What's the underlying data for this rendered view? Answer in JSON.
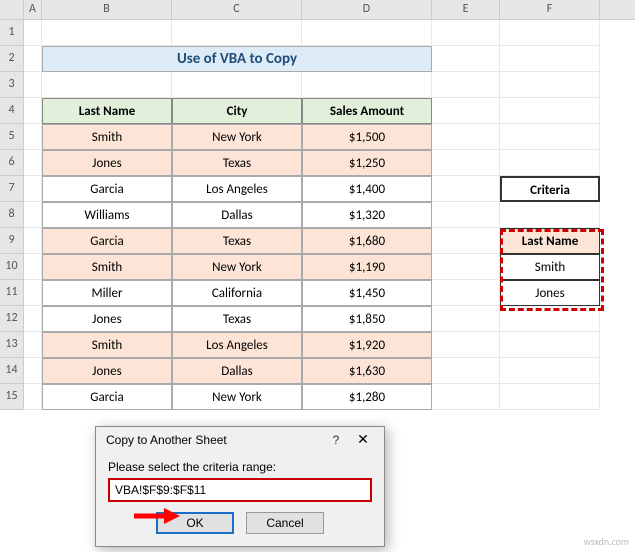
{
  "columns": [
    "A",
    "B",
    "C",
    "D",
    "E",
    "F"
  ],
  "row_numbers": [
    "1",
    "2",
    "3",
    "4",
    "5",
    "6",
    "7",
    "8",
    "9",
    "10",
    "11",
    "12",
    "13",
    "14",
    "15"
  ],
  "title": "Use of VBA to Copy",
  "table": {
    "headers": [
      "Last Name",
      "City",
      "Sales Amount"
    ],
    "rows": [
      {
        "last": "Smith",
        "city": "New York",
        "amt": "$1,500",
        "alt": true
      },
      {
        "last": "Jones",
        "city": "Texas",
        "amt": "$1,250",
        "alt": true
      },
      {
        "last": "Garcia",
        "city": "Los Angeles",
        "amt": "$1,400",
        "alt": false
      },
      {
        "last": "Williams",
        "city": "Dallas",
        "amt": "$1,320",
        "alt": false
      },
      {
        "last": "Garcia",
        "city": "Texas",
        "amt": "$1,680",
        "alt": true
      },
      {
        "last": "Smith",
        "city": "New York",
        "amt": "$1,190",
        "alt": true
      },
      {
        "last": "Miller",
        "city": "California",
        "amt": "$1,450",
        "alt": false
      },
      {
        "last": "Jones",
        "city": "Texas",
        "amt": "$1,850",
        "alt": false
      },
      {
        "last": "Smith",
        "city": "Los Angeles",
        "amt": "$1,920",
        "alt": true
      },
      {
        "last": "Jones",
        "city": "Dallas",
        "amt": "$1,630",
        "alt": true
      },
      {
        "last": "Garcia",
        "city": "New York",
        "amt": "$1,280",
        "alt": false
      }
    ]
  },
  "criteria": {
    "title": "Criteria",
    "header": "Last Name",
    "values": [
      "Smith",
      "Jones"
    ]
  },
  "dialog": {
    "title": "Copy to Another Sheet",
    "label": "Please select the criteria range:",
    "input_value": "VBA!$F$9:$F$11",
    "ok": "OK",
    "cancel": "Cancel"
  },
  "watermark": "wsxdn.com",
  "chart_data": {
    "type": "table",
    "title": "Use of VBA to Copy",
    "columns": [
      "Last Name",
      "City",
      "Sales Amount"
    ],
    "rows": [
      [
        "Smith",
        "New York",
        1500
      ],
      [
        "Jones",
        "Texas",
        1250
      ],
      [
        "Garcia",
        "Los Angeles",
        1400
      ],
      [
        "Williams",
        "Dallas",
        1320
      ],
      [
        "Garcia",
        "Texas",
        1680
      ],
      [
        "Smith",
        "New York",
        1190
      ],
      [
        "Miller",
        "California",
        1450
      ],
      [
        "Jones",
        "Texas",
        1850
      ],
      [
        "Smith",
        "Los Angeles",
        1920
      ],
      [
        "Jones",
        "Dallas",
        1630
      ],
      [
        "Garcia",
        "New York",
        1280
      ]
    ],
    "criteria_range": {
      "header": "Last Name",
      "values": [
        "Smith",
        "Jones"
      ]
    }
  }
}
